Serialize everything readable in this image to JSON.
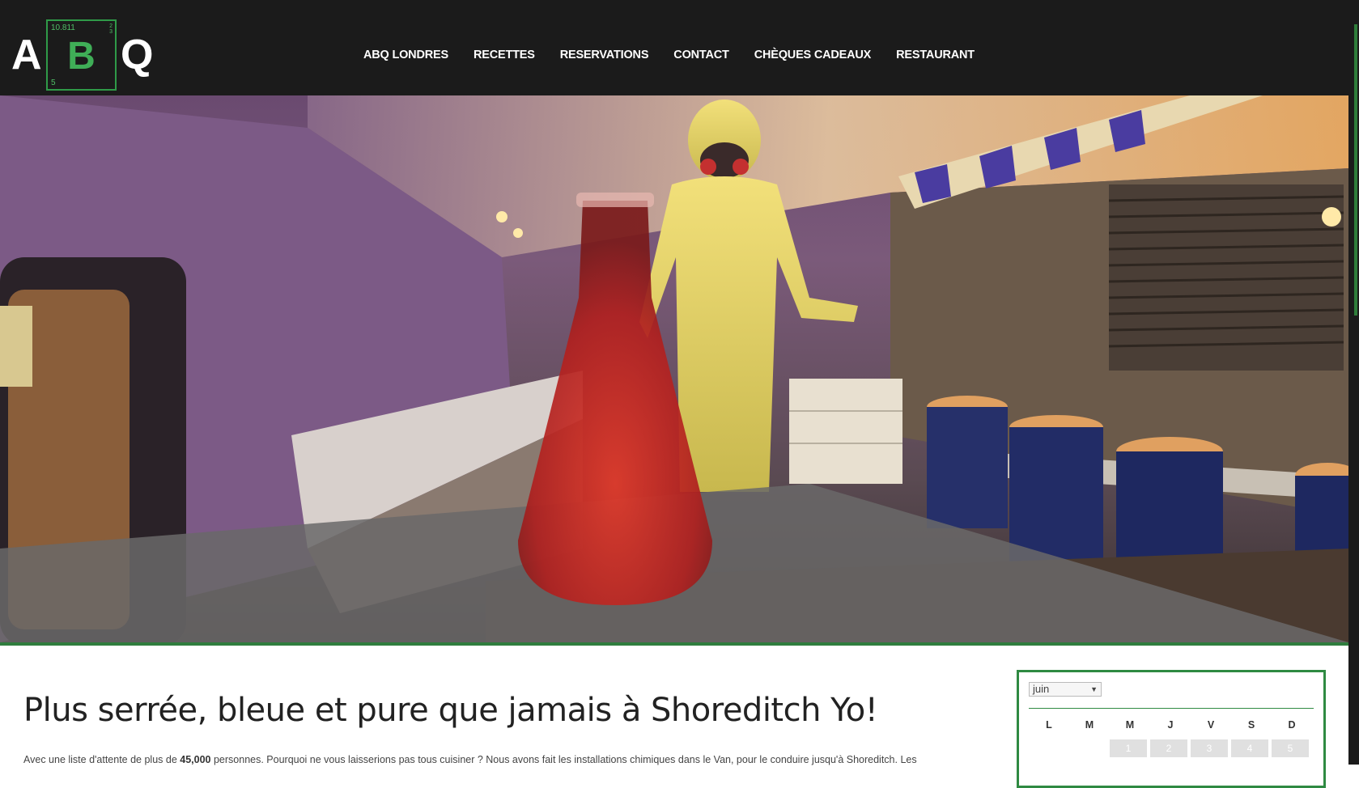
{
  "logo": {
    "left": "A",
    "element_symbol": "B",
    "atomic_mass": "10.811",
    "atomic_number": "5",
    "shell": [
      "2",
      "3"
    ],
    "right": "Q"
  },
  "nav": {
    "items": [
      {
        "label": "ABQ LONDRES"
      },
      {
        "label": "RECETTES"
      },
      {
        "label": "RESERVATIONS"
      },
      {
        "label": "CONTACT"
      },
      {
        "label": "CHÈQUES CADEAUX"
      },
      {
        "label": "RESTAURANT"
      }
    ]
  },
  "main": {
    "title": "Plus serrée, bleue et pure que jamais à Shoreditch Yo!",
    "intro_before": "Avec une liste d'attente de plus de ",
    "intro_bold": "45,000",
    "intro_after": " personnes. Pourquoi ne vous laisserions pas tous cuisiner ? Nous avons fait les installations chimiques dans le Van, pour le conduire jusqu'à Shoreditch. Les"
  },
  "calendar": {
    "month": "juin",
    "weekdays": [
      "L",
      "M",
      "M",
      "J",
      "V",
      "S",
      "D"
    ],
    "first_row": [
      "",
      "",
      "1",
      "2",
      "3",
      "4",
      "5"
    ]
  },
  "colors": {
    "header_bg": "#1b1b1b",
    "accent_green": "#2f8a42",
    "title_text": "#222222"
  }
}
